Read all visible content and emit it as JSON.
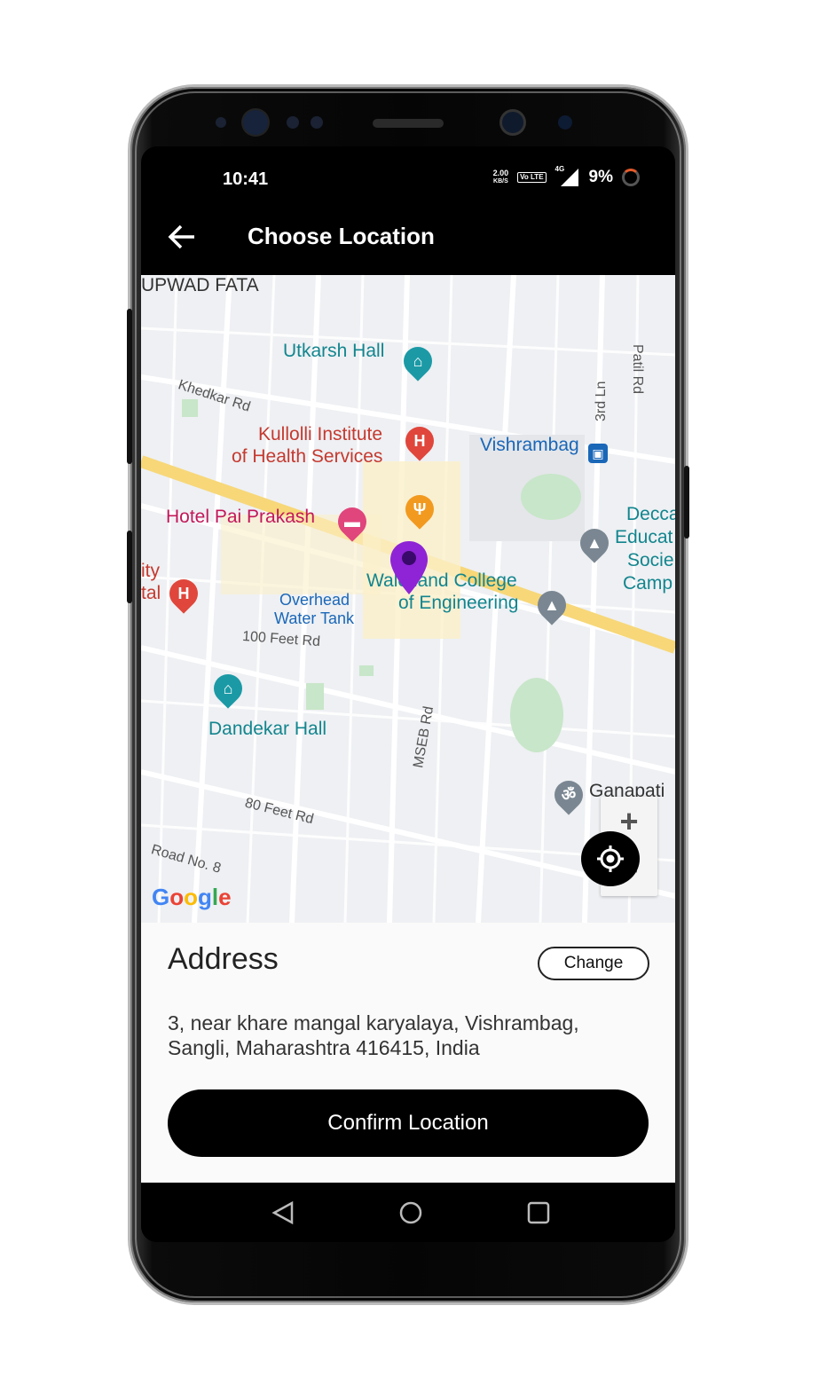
{
  "status_bar": {
    "time": "10:41",
    "network_speed_value": "2.00",
    "network_speed_unit": "KB/S",
    "volte": "Vo LTE",
    "network_type": "4G",
    "battery": "9%"
  },
  "app_bar": {
    "title": "Choose Location",
    "back_icon": "arrow-left-icon"
  },
  "map": {
    "labels": {
      "kupwad_fata": "UPWAD FATA",
      "utkarsh_hall": "Utkarsh Hall",
      "khedkar_rd": "Khedkar Rd",
      "kullolli_line1": "Kullolli Institute",
      "kullolli_line2": "of Health Services",
      "vishrambag": "Vishrambag",
      "hotel_pai": "Hotel Pai Prakash",
      "walchand_line1": "Walchand College",
      "walchand_line2": "of Engineering",
      "deccan_line1": "Decca",
      "deccan_line2": "Educat",
      "deccan_line3": "Socie",
      "deccan_line4": "Camp",
      "city_hospital_line1": "ity",
      "city_hospital_line2": "tal",
      "overhead_line1": "Overhead",
      "overhead_line2": "Water Tank",
      "feet_100": "100 Feet Rd",
      "dandekar_hall": "Dandekar Hall",
      "mseb_rd": "MSEB Rd",
      "ganapati": "Ganapati",
      "feet_80": "80 Feet Rd",
      "road_no8": "Road No. 8",
      "patil_rd": "Patil Rd",
      "third_ln": "3rd Ln"
    },
    "google_logo": [
      "G",
      "o",
      "o",
      "g",
      "l",
      "e"
    ],
    "zoom_in": "+",
    "zoom_out": "−",
    "my_location_icon": "crosshair-icon",
    "marker_color": "#8e24d6"
  },
  "address_panel": {
    "heading": "Address",
    "change_label": "Change",
    "address_line1": "3, near khare mangal karyalaya, Vishrambag,",
    "address_line2": "Sangli, Maharashtra 416415, India",
    "confirm_label": "Confirm Location"
  },
  "colors": {
    "teal_poi": "#1b9aa6",
    "red_poi": "#e0463b",
    "pink_poi": "#e0457b",
    "orange_poi": "#f29a1f",
    "gray_poi": "#7a8792",
    "road_major": "#f7d778"
  }
}
